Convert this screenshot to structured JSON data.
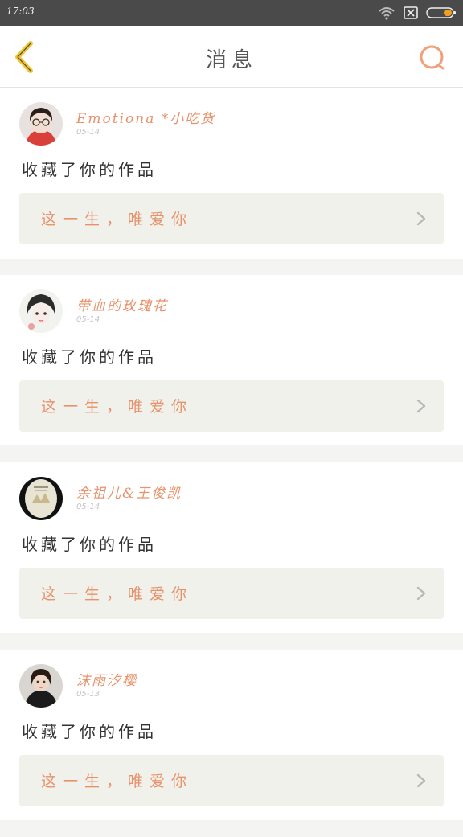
{
  "status_bar": {
    "time": "17:03"
  },
  "header": {
    "title": "消息",
    "back_icon": "chevron-left-icon",
    "search_icon": "search-icon"
  },
  "theme": {
    "accent": "#e8926b",
    "back_arrow": "#f2c32a",
    "card_bg": "#f1f1ec"
  },
  "messages": [
    {
      "user": "Emotiona *小吃货",
      "time": "05-14",
      "action": "收藏了你的作品",
      "work_title": "这一生，唯爱你"
    },
    {
      "user": "带血的玫瑰花",
      "time": "05-14",
      "action": "收藏了你的作品",
      "work_title": "这一生，唯爱你"
    },
    {
      "user": "余祖儿&王俊凯",
      "time": "05-14",
      "action": "收藏了你的作品",
      "work_title": "这一生，唯爱你"
    },
    {
      "user": "沫雨汐樱",
      "time": "05-13",
      "action": "收藏了你的作品",
      "work_title": "这一生，唯爱你"
    }
  ]
}
